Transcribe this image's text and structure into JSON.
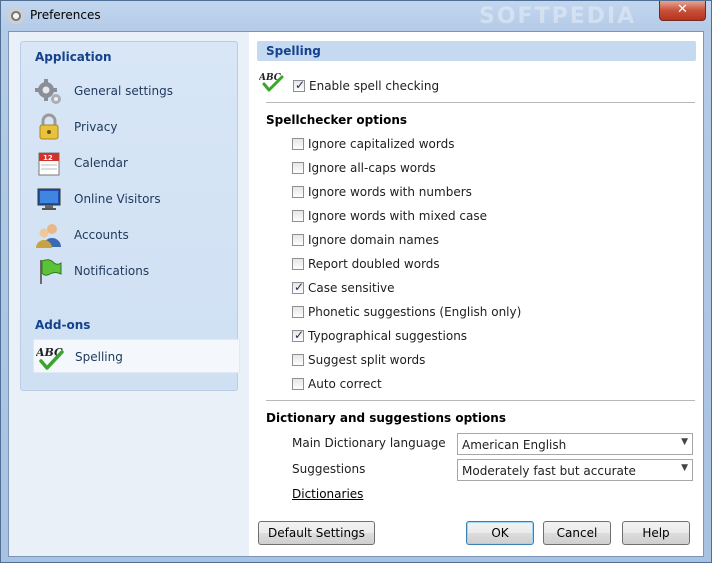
{
  "window": {
    "title": "Preferences",
    "watermark": "SOFTPEDIA",
    "close_label": "✕"
  },
  "sidebar": {
    "application_heading": "Application",
    "addons_heading": "Add-ons",
    "items": [
      {
        "label": "General settings",
        "icon": "gears-icon"
      },
      {
        "label": "Privacy",
        "icon": "padlock-icon"
      },
      {
        "label": "Calendar",
        "icon": "calendar-icon"
      },
      {
        "label": "Online Visitors",
        "icon": "monitor-icon"
      },
      {
        "label": "Accounts",
        "icon": "users-icon"
      },
      {
        "label": "Notifications",
        "icon": "flag-icon"
      }
    ],
    "addon_items": [
      {
        "label": "Spelling",
        "icon": "abc-check-icon",
        "selected": true
      }
    ]
  },
  "spelling": {
    "header": "Spelling",
    "enable_label": "Enable spell checking",
    "enable_checked": true,
    "abc_icon_text": "ABC"
  },
  "spellchecker": {
    "title": "Spellchecker options",
    "options": [
      {
        "label": "Ignore capitalized words",
        "checked": false
      },
      {
        "label": "Ignore all-caps words",
        "checked": false
      },
      {
        "label": "Ignore words with numbers",
        "checked": false
      },
      {
        "label": "Ignore words with mixed case",
        "checked": false
      },
      {
        "label": "Ignore domain names",
        "checked": false
      },
      {
        "label": "Report doubled words",
        "checked": false
      },
      {
        "label": "Case sensitive",
        "checked": true
      },
      {
        "label": "Phonetic suggestions (English only)",
        "checked": false
      },
      {
        "label": "Typographical suggestions",
        "checked": true
      },
      {
        "label": "Suggest split words",
        "checked": false
      },
      {
        "label": "Auto correct",
        "checked": false
      }
    ]
  },
  "dictionary": {
    "title": "Dictionary and suggestions options",
    "main_language_label": "Main Dictionary language",
    "main_language_value": "American English",
    "suggestions_label": "Suggestions",
    "suggestions_value": "Moderately fast but accurate",
    "dictionaries_link": "Dictionaries"
  },
  "buttons": {
    "default_settings": "Default Settings",
    "ok": "OK",
    "cancel": "Cancel",
    "help": "Help"
  },
  "colors": {
    "accent": "#15428b",
    "selection": "#f4f8fc"
  }
}
